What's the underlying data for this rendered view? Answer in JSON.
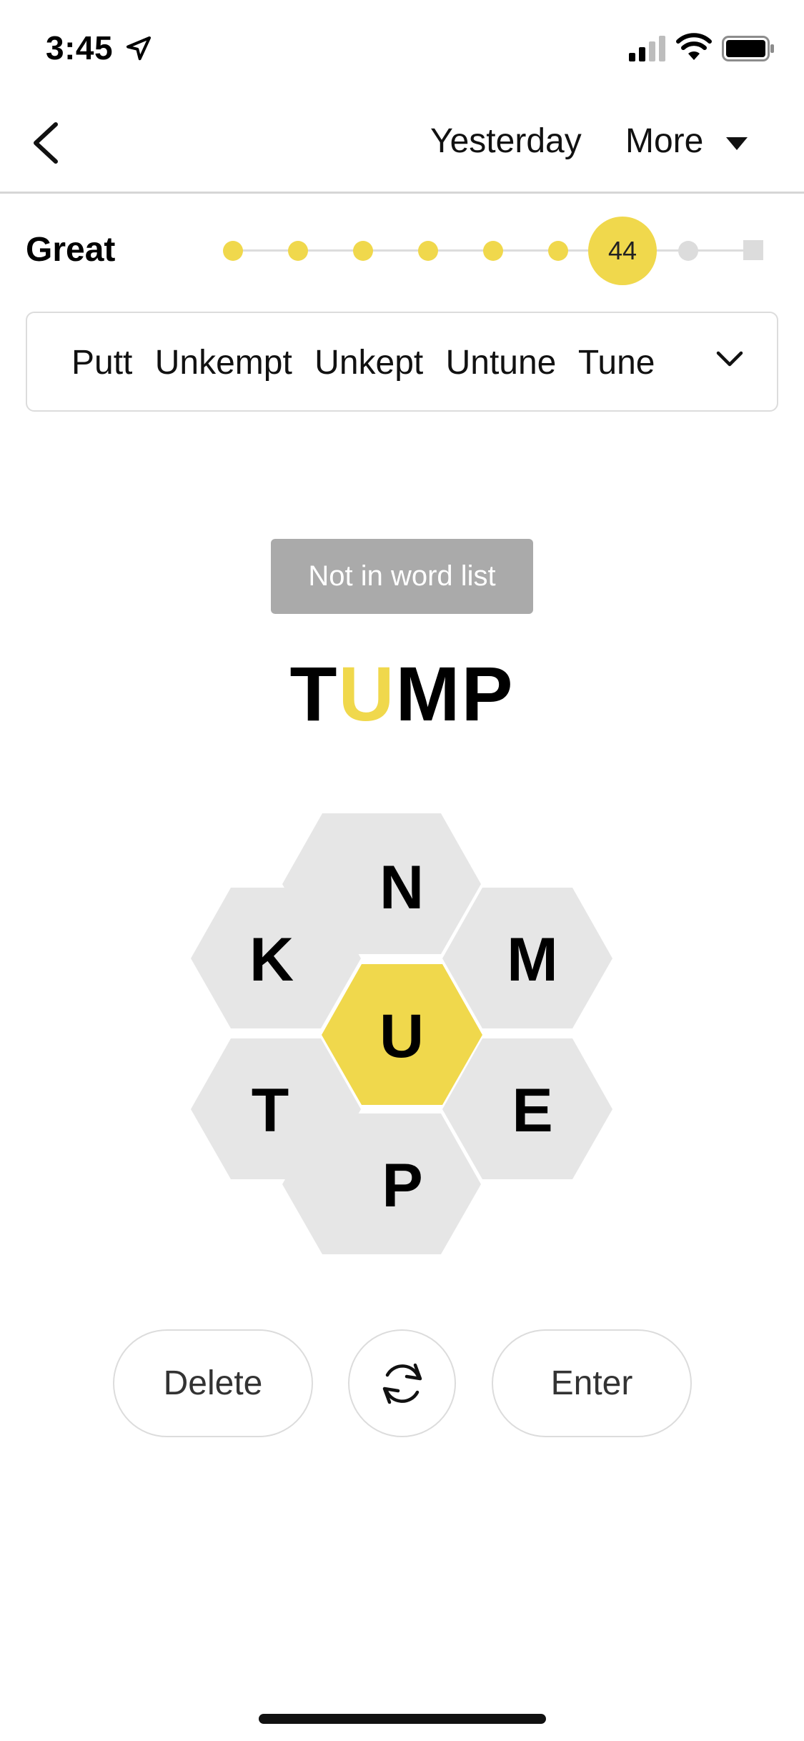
{
  "status_bar": {
    "time": "3:45"
  },
  "nav": {
    "yesterday_label": "Yesterday",
    "more_label": "More"
  },
  "progress": {
    "rank": "Great",
    "score": "44",
    "levels_total": 9,
    "levels_reached": 7,
    "accent_color": "#f0d84c",
    "inactive_color": "#dcdcdc"
  },
  "found_words": [
    "Putt",
    "Unkempt",
    "Unkept",
    "Untune",
    "Tune"
  ],
  "toast": {
    "message": "Not in word list"
  },
  "input": {
    "letters": [
      "T",
      "U",
      "M",
      "P"
    ],
    "center_letter": "U"
  },
  "hive": {
    "center": "U",
    "outer": {
      "top": "N",
      "upper_left": "K",
      "upper_right": "M",
      "lower_left": "T",
      "lower_right": "E",
      "bottom": "P"
    },
    "center_color": "#f0d84c",
    "outer_color": "#e6e6e6"
  },
  "buttons": {
    "delete_label": "Delete",
    "enter_label": "Enter",
    "shuffle_icon": "shuffle-icon"
  }
}
